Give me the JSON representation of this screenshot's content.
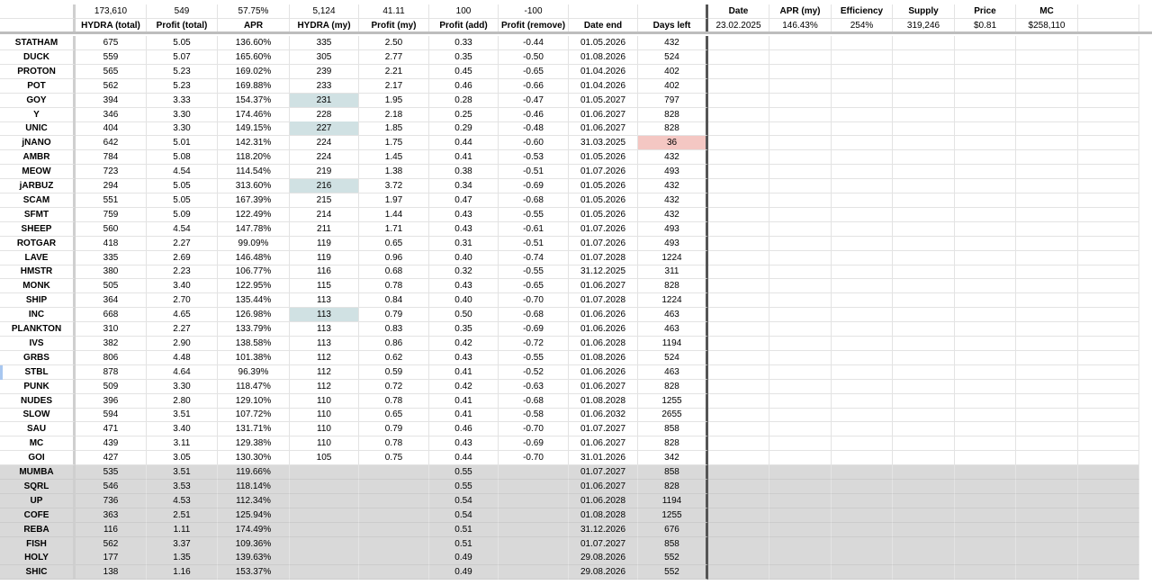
{
  "header_totals": {
    "hydra_total": "173,610",
    "profit_total": "549",
    "apr": "57.75%",
    "hydra_my": "5,124",
    "profit_my": "41.11",
    "profit_add": "100",
    "profit_remove": "-100"
  },
  "columns": [
    "HYDRA (total)",
    "Profit (total)",
    "APR",
    "HYDRA (my)",
    "Profit (my)",
    "Profit (add)",
    "Profit (remove)",
    "Date end",
    "Days left"
  ],
  "summary": {
    "headers": [
      "Date",
      "APR (my)",
      "Efficiency",
      "Supply",
      "Price",
      "MC"
    ],
    "values": [
      "23.02.2025",
      "146.43%",
      "254%",
      "319,246",
      "$0.81",
      "$258,110"
    ]
  },
  "rows": [
    {
      "name": "STATHAM",
      "hydra_total": "675",
      "profit_total": "5.05",
      "apr": "136.60%",
      "hydra_my": "335",
      "profit_my": "2.50",
      "profit_add": "0.33",
      "profit_remove": "-0.44",
      "date_end": "01.05.2026",
      "days_left": "432"
    },
    {
      "name": "DUCK",
      "hydra_total": "559",
      "profit_total": "5.07",
      "apr": "165.60%",
      "hydra_my": "305",
      "profit_my": "2.77",
      "profit_add": "0.35",
      "profit_remove": "-0.50",
      "date_end": "01.08.2026",
      "days_left": "524"
    },
    {
      "name": "PROTON",
      "hydra_total": "565",
      "profit_total": "5.23",
      "apr": "169.02%",
      "hydra_my": "239",
      "profit_my": "2.21",
      "profit_add": "0.45",
      "profit_remove": "-0.65",
      "date_end": "01.04.2026",
      "days_left": "402"
    },
    {
      "name": "POT",
      "hydra_total": "562",
      "profit_total": "5.23",
      "apr": "169.88%",
      "hydra_my": "233",
      "profit_my": "2.17",
      "profit_add": "0.46",
      "profit_remove": "-0.66",
      "date_end": "01.04.2026",
      "days_left": "402"
    },
    {
      "name": "GOY",
      "hydra_total": "394",
      "profit_total": "3.33",
      "apr": "154.37%",
      "hydra_my": "231",
      "profit_my": "1.95",
      "profit_add": "0.28",
      "profit_remove": "-0.47",
      "date_end": "01.05.2027",
      "days_left": "797",
      "hl": "blue"
    },
    {
      "name": "Y",
      "hydra_total": "346",
      "profit_total": "3.30",
      "apr": "174.46%",
      "hydra_my": "228",
      "profit_my": "2.18",
      "profit_add": "0.25",
      "profit_remove": "-0.46",
      "date_end": "01.06.2027",
      "days_left": "828"
    },
    {
      "name": "UNIC",
      "hydra_total": "404",
      "profit_total": "3.30",
      "apr": "149.15%",
      "hydra_my": "227",
      "profit_my": "1.85",
      "profit_add": "0.29",
      "profit_remove": "-0.48",
      "date_end": "01.06.2027",
      "days_left": "828",
      "hl": "blue"
    },
    {
      "name": "jNANO",
      "hydra_total": "642",
      "profit_total": "5.01",
      "apr": "142.31%",
      "hydra_my": "224",
      "profit_my": "1.75",
      "profit_add": "0.44",
      "profit_remove": "-0.60",
      "date_end": "31.03.2025",
      "days_left": "36",
      "hl_days": "red"
    },
    {
      "name": "AMBR",
      "hydra_total": "784",
      "profit_total": "5.08",
      "apr": "118.20%",
      "hydra_my": "224",
      "profit_my": "1.45",
      "profit_add": "0.41",
      "profit_remove": "-0.53",
      "date_end": "01.05.2026",
      "days_left": "432"
    },
    {
      "name": "MEOW",
      "hydra_total": "723",
      "profit_total": "4.54",
      "apr": "114.54%",
      "hydra_my": "219",
      "profit_my": "1.38",
      "profit_add": "0.38",
      "profit_remove": "-0.51",
      "date_end": "01.07.2026",
      "days_left": "493"
    },
    {
      "name": "jARBUZ",
      "hydra_total": "294",
      "profit_total": "5.05",
      "apr": "313.60%",
      "hydra_my": "216",
      "profit_my": "3.72",
      "profit_add": "0.34",
      "profit_remove": "-0.69",
      "date_end": "01.05.2026",
      "days_left": "432",
      "hl": "blue"
    },
    {
      "name": "SCAM",
      "hydra_total": "551",
      "profit_total": "5.05",
      "apr": "167.39%",
      "hydra_my": "215",
      "profit_my": "1.97",
      "profit_add": "0.47",
      "profit_remove": "-0.68",
      "date_end": "01.05.2026",
      "days_left": "432"
    },
    {
      "name": "SFMT",
      "hydra_total": "759",
      "profit_total": "5.09",
      "apr": "122.49%",
      "hydra_my": "214",
      "profit_my": "1.44",
      "profit_add": "0.43",
      "profit_remove": "-0.55",
      "date_end": "01.05.2026",
      "days_left": "432"
    },
    {
      "name": "SHEEP",
      "hydra_total": "560",
      "profit_total": "4.54",
      "apr": "147.78%",
      "hydra_my": "211",
      "profit_my": "1.71",
      "profit_add": "0.43",
      "profit_remove": "-0.61",
      "date_end": "01.07.2026",
      "days_left": "493"
    },
    {
      "name": "ROTGAR",
      "hydra_total": "418",
      "profit_total": "2.27",
      "apr": "99.09%",
      "hydra_my": "119",
      "profit_my": "0.65",
      "profit_add": "0.31",
      "profit_remove": "-0.51",
      "date_end": "01.07.2026",
      "days_left": "493"
    },
    {
      "name": "LAVE",
      "hydra_total": "335",
      "profit_total": "2.69",
      "apr": "146.48%",
      "hydra_my": "119",
      "profit_my": "0.96",
      "profit_add": "0.40",
      "profit_remove": "-0.74",
      "date_end": "01.07.2028",
      "days_left": "1224"
    },
    {
      "name": "HMSTR",
      "hydra_total": "380",
      "profit_total": "2.23",
      "apr": "106.77%",
      "hydra_my": "116",
      "profit_my": "0.68",
      "profit_add": "0.32",
      "profit_remove": "-0.55",
      "date_end": "31.12.2025",
      "days_left": "311"
    },
    {
      "name": "MONK",
      "hydra_total": "505",
      "profit_total": "3.40",
      "apr": "122.95%",
      "hydra_my": "115",
      "profit_my": "0.78",
      "profit_add": "0.43",
      "profit_remove": "-0.65",
      "date_end": "01.06.2027",
      "days_left": "828"
    },
    {
      "name": "SHIP",
      "hydra_total": "364",
      "profit_total": "2.70",
      "apr": "135.44%",
      "hydra_my": "113",
      "profit_my": "0.84",
      "profit_add": "0.40",
      "profit_remove": "-0.70",
      "date_end": "01.07.2028",
      "days_left": "1224"
    },
    {
      "name": "INC",
      "hydra_total": "668",
      "profit_total": "4.65",
      "apr": "126.98%",
      "hydra_my": "113",
      "profit_my": "0.79",
      "profit_add": "0.50",
      "profit_remove": "-0.68",
      "date_end": "01.06.2026",
      "days_left": "463",
      "hl": "blue"
    },
    {
      "name": "PLANKTON",
      "hydra_total": "310",
      "profit_total": "2.27",
      "apr": "133.79%",
      "hydra_my": "113",
      "profit_my": "0.83",
      "profit_add": "0.35",
      "profit_remove": "-0.69",
      "date_end": "01.06.2026",
      "days_left": "463"
    },
    {
      "name": "IVS",
      "hydra_total": "382",
      "profit_total": "2.90",
      "apr": "138.58%",
      "hydra_my": "113",
      "profit_my": "0.86",
      "profit_add": "0.42",
      "profit_remove": "-0.72",
      "date_end": "01.06.2028",
      "days_left": "1194"
    },
    {
      "name": "GRBS",
      "hydra_total": "806",
      "profit_total": "4.48",
      "apr": "101.38%",
      "hydra_my": "112",
      "profit_my": "0.62",
      "profit_add": "0.43",
      "profit_remove": "-0.55",
      "date_end": "01.08.2026",
      "days_left": "524"
    },
    {
      "name": "STBL",
      "hydra_total": "878",
      "profit_total": "4.64",
      "apr": "96.39%",
      "hydra_my": "112",
      "profit_my": "0.59",
      "profit_add": "0.41",
      "profit_remove": "-0.52",
      "date_end": "01.06.2026",
      "days_left": "463",
      "mark": true
    },
    {
      "name": "PUNK",
      "hydra_total": "509",
      "profit_total": "3.30",
      "apr": "118.47%",
      "hydra_my": "112",
      "profit_my": "0.72",
      "profit_add": "0.42",
      "profit_remove": "-0.63",
      "date_end": "01.06.2027",
      "days_left": "828"
    },
    {
      "name": "NUDES",
      "hydra_total": "396",
      "profit_total": "2.80",
      "apr": "129.10%",
      "hydra_my": "110",
      "profit_my": "0.78",
      "profit_add": "0.41",
      "profit_remove": "-0.68",
      "date_end": "01.08.2028",
      "days_left": "1255"
    },
    {
      "name": "SLOW",
      "hydra_total": "594",
      "profit_total": "3.51",
      "apr": "107.72%",
      "hydra_my": "110",
      "profit_my": "0.65",
      "profit_add": "0.41",
      "profit_remove": "-0.58",
      "date_end": "01.06.2032",
      "days_left": "2655"
    },
    {
      "name": "SAU",
      "hydra_total": "471",
      "profit_total": "3.40",
      "apr": "131.71%",
      "hydra_my": "110",
      "profit_my": "0.79",
      "profit_add": "0.46",
      "profit_remove": "-0.70",
      "date_end": "01.07.2027",
      "days_left": "858"
    },
    {
      "name": "MC",
      "hydra_total": "439",
      "profit_total": "3.11",
      "apr": "129.38%",
      "hydra_my": "110",
      "profit_my": "0.78",
      "profit_add": "0.43",
      "profit_remove": "-0.69",
      "date_end": "01.06.2027",
      "days_left": "828"
    },
    {
      "name": "GOI",
      "hydra_total": "427",
      "profit_total": "3.05",
      "apr": "130.30%",
      "hydra_my": "105",
      "profit_my": "0.75",
      "profit_add": "0.44",
      "profit_remove": "-0.70",
      "date_end": "31.01.2026",
      "days_left": "342"
    },
    {
      "name": "MUMBA",
      "hydra_total": "535",
      "profit_total": "3.51",
      "apr": "119.66%",
      "hydra_my": "",
      "profit_my": "",
      "profit_add": "0.55",
      "profit_remove": "",
      "date_end": "01.07.2027",
      "days_left": "858",
      "grey": true
    },
    {
      "name": "SQRL",
      "hydra_total": "546",
      "profit_total": "3.53",
      "apr": "118.14%",
      "hydra_my": "",
      "profit_my": "",
      "profit_add": "0.55",
      "profit_remove": "",
      "date_end": "01.06.2027",
      "days_left": "828",
      "grey": true
    },
    {
      "name": "UP",
      "hydra_total": "736",
      "profit_total": "4.53",
      "apr": "112.34%",
      "hydra_my": "",
      "profit_my": "",
      "profit_add": "0.54",
      "profit_remove": "",
      "date_end": "01.06.2028",
      "days_left": "1194",
      "grey": true
    },
    {
      "name": "COFE",
      "hydra_total": "363",
      "profit_total": "2.51",
      "apr": "125.94%",
      "hydra_my": "",
      "profit_my": "",
      "profit_add": "0.54",
      "profit_remove": "",
      "date_end": "01.08.2028",
      "days_left": "1255",
      "grey": true
    },
    {
      "name": "REBA",
      "hydra_total": "116",
      "profit_total": "1.11",
      "apr": "174.49%",
      "hydra_my": "",
      "profit_my": "",
      "profit_add": "0.51",
      "profit_remove": "",
      "date_end": "31.12.2026",
      "days_left": "676",
      "grey": true
    },
    {
      "name": "FISH",
      "hydra_total": "562",
      "profit_total": "3.37",
      "apr": "109.36%",
      "hydra_my": "",
      "profit_my": "",
      "profit_add": "0.51",
      "profit_remove": "",
      "date_end": "01.07.2027",
      "days_left": "858",
      "grey": true
    },
    {
      "name": "HOLY",
      "hydra_total": "177",
      "profit_total": "1.35",
      "apr": "139.63%",
      "hydra_my": "",
      "profit_my": "",
      "profit_add": "0.49",
      "profit_remove": "",
      "date_end": "29.08.2026",
      "days_left": "552",
      "grey": true
    },
    {
      "name": "SHIC",
      "hydra_total": "138",
      "profit_total": "1.16",
      "apr": "153.37%",
      "hydra_my": "",
      "profit_my": "",
      "profit_add": "0.49",
      "profit_remove": "",
      "date_end": "29.08.2026",
      "days_left": "552",
      "grey": true
    }
  ],
  "colors": {
    "highlight_blue": "#d0e1e3",
    "highlight_red": "#f4c7c3",
    "grey_rows": "#d9d9d9"
  }
}
